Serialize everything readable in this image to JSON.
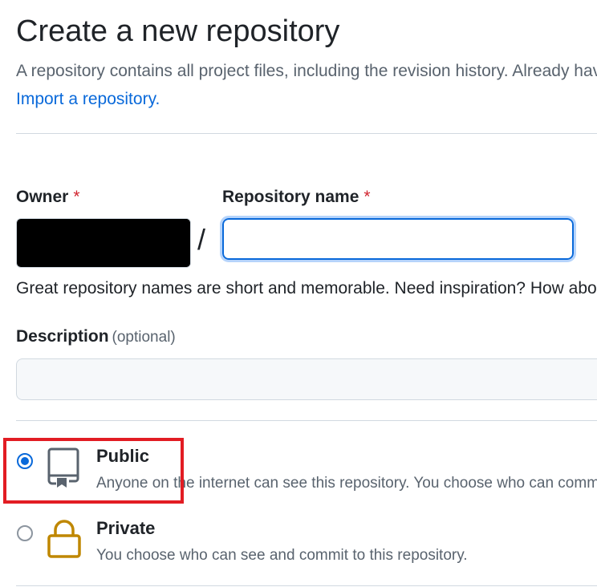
{
  "page": {
    "title": "Create a new repository",
    "intro": "A repository contains all project files, including the revision history. Already have a project repository elsewhere?",
    "import_link": "Import a repository."
  },
  "owner": {
    "label": "Owner",
    "required_mark": "*"
  },
  "separator": "/",
  "repo_name": {
    "label": "Repository name",
    "required_mark": "*",
    "value": "",
    "hint": "Great repository names are short and memorable. Need inspiration? How about"
  },
  "description": {
    "label": "Description",
    "optional": "(optional)",
    "value": ""
  },
  "visibility": {
    "options": [
      {
        "title": "Public",
        "desc": "Anyone on the internet can see this repository. You choose who can commit.",
        "icon": "repo-icon",
        "selected": true
      },
      {
        "title": "Private",
        "desc": "You choose who can see and commit to this repository.",
        "icon": "lock-icon",
        "selected": false
      }
    ]
  },
  "colors": {
    "accent": "#0969da",
    "required": "#d1242f",
    "highlight": "#e21c23",
    "lock": "#bf8700"
  }
}
